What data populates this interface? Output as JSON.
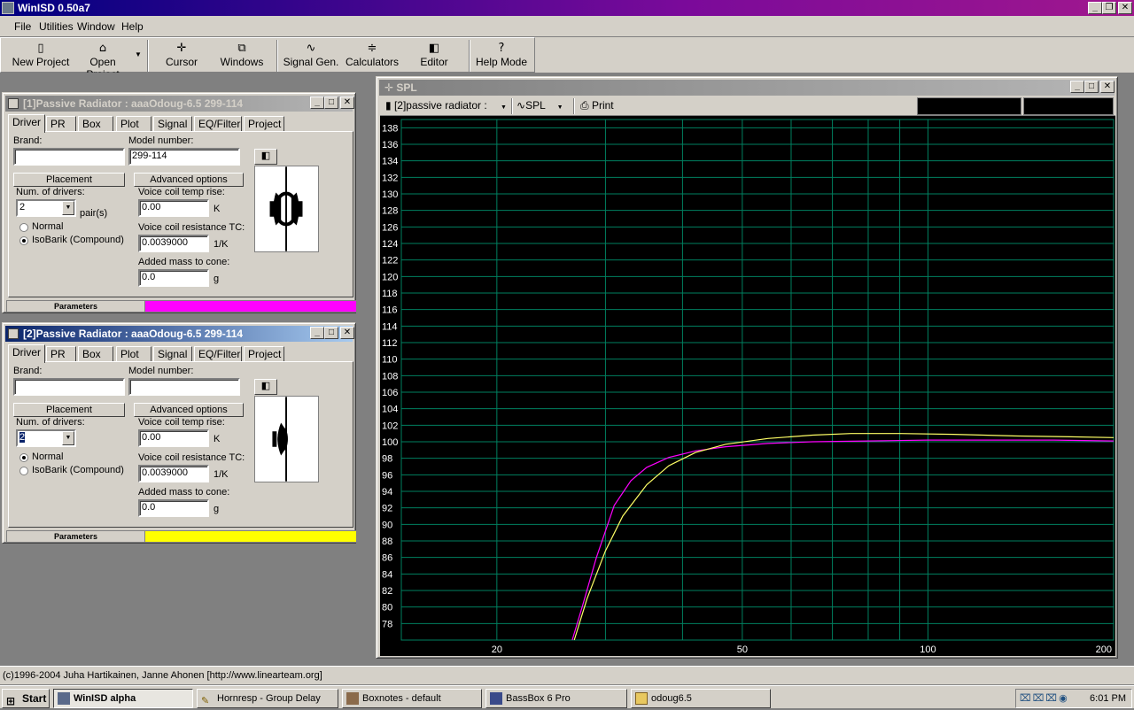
{
  "app": {
    "title": "WinISD 0.50a7",
    "caption_buttons": [
      "minimize-icon",
      "restore-icon",
      "close-icon"
    ]
  },
  "menu": {
    "items": [
      {
        "label": "File"
      },
      {
        "label": "Utilities"
      },
      {
        "label": "Window"
      },
      {
        "label": "Help"
      }
    ]
  },
  "toolbar": {
    "buttons": [
      {
        "label": "New Project",
        "icon": "new-project-icon"
      },
      {
        "label": "Open Project",
        "icon": "open-folder-icon"
      },
      {
        "label": "Cursor",
        "icon": "crosshair-icon"
      },
      {
        "label": "Windows",
        "icon": "windows-icon"
      },
      {
        "label": "Signal Gen.",
        "icon": "sine-wave-icon"
      },
      {
        "label": "Calculators",
        "icon": "calculator-icon"
      },
      {
        "label": "Editor",
        "icon": "speaker-icon"
      },
      {
        "label": "Help Mode",
        "icon": "help-question-icon"
      }
    ]
  },
  "window1": {
    "title": "[1]Passive Radiator : aaaOdoug-6.5 299-114",
    "tabs": [
      "Driver",
      "PR",
      "Box",
      "Plot",
      "Signal",
      "EQ/Filter",
      "Project"
    ],
    "brand_label": "Brand:",
    "brand_value": "",
    "model_label": "Model number:",
    "model_value": "299-114",
    "placement_button": "Placement",
    "advanced_button": "Advanced options",
    "num_drivers_label": "Num. of drivers:",
    "num_drivers_value": "2",
    "pairs_suffix": "pair(s)",
    "radio_normal": "Normal",
    "radio_isobarik": "IsoBarik (Compound)",
    "selected_mode": "IsoBarik (Compound)",
    "vc_temp_label": "Voice coil temp rise:",
    "vc_temp_value": "0.00",
    "vc_temp_unit": "K",
    "vc_res_label": "Voice coil resistance TC:",
    "vc_res_value": "0.0039000",
    "vc_res_unit": "1/K",
    "mass_label": "Added mass to cone:",
    "mass_value": "0.0",
    "mass_unit": "g",
    "params_label": "Parameters",
    "color": "#ff00ff"
  },
  "window2": {
    "title": "[2]Passive Radiator : aaaOdoug-6.5 299-114",
    "tabs": [
      "Driver",
      "PR",
      "Box",
      "Plot",
      "Signal",
      "EQ/Filter",
      "Project"
    ],
    "brand_label": "Brand:",
    "brand_value": "",
    "model_label": "Model number:",
    "model_value": "",
    "placement_button": "Placement",
    "advanced_button": "Advanced options",
    "num_drivers_label": "Num. of drivers:",
    "num_drivers_value": "2",
    "radio_normal": "Normal",
    "radio_isobarik": "IsoBarik (Compound)",
    "selected_mode": "Normal",
    "vc_temp_label": "Voice coil temp rise:",
    "vc_temp_value": "0.00",
    "vc_temp_unit": "K",
    "vc_res_label": "Voice coil resistance TC:",
    "vc_res_value": "0.0039000",
    "vc_res_unit": "1/K",
    "mass_label": "Added mass to cone:",
    "mass_value": "0.0",
    "mass_unit": "g",
    "params_label": "Parameters",
    "color": "#ffff00"
  },
  "spl_window": {
    "title": "SPL",
    "project_select": "[2]passive radiator :",
    "graph_select": "SPL",
    "print_label": "Print"
  },
  "chart_data": {
    "type": "line",
    "xscale": "log",
    "xlim": [
      14,
      200
    ],
    "ylim": [
      76,
      139
    ],
    "x_ticks": [
      20,
      50,
      100,
      200
    ],
    "y_ticks": [
      78,
      80,
      82,
      84,
      86,
      88,
      90,
      92,
      94,
      96,
      98,
      100,
      102,
      104,
      106,
      108,
      110,
      112,
      114,
      116,
      118,
      120,
      122,
      124,
      126,
      128,
      130,
      132,
      134,
      136,
      138
    ],
    "grid": true,
    "background": "#000000",
    "grid_color": "#008060",
    "series": [
      {
        "color": "#ff00ff",
        "x": [
          26.5,
          27.5,
          29,
          31,
          33,
          35,
          38,
          42,
          47,
          55,
          65,
          80,
          100,
          130,
          160,
          200
        ],
        "y": [
          76,
          80,
          86,
          92.3,
          95.3,
          96.9,
          98.1,
          98.9,
          99.4,
          99.8,
          100.0,
          100.1,
          100.2,
          100.2,
          100.2,
          100.1
        ]
      },
      {
        "color": "#ffff66",
        "x": [
          26.7,
          28,
          30,
          32,
          35,
          38,
          42,
          47,
          55,
          65,
          75,
          90,
          110,
          140,
          170,
          200
        ],
        "y": [
          76,
          81,
          86.8,
          91,
          94.8,
          97.1,
          98.7,
          99.7,
          100.4,
          100.8,
          101.0,
          101.0,
          100.9,
          100.7,
          100.6,
          100.5
        ]
      }
    ]
  },
  "status": {
    "text": "(c)1996-2004 Juha Hartikainen, Janne Ahonen [http://www.linearteam.org]"
  },
  "taskbar": {
    "start_label": "Start",
    "tasks": [
      {
        "label": "WinISD alpha",
        "active": true
      },
      {
        "label": "Hornresp - Group Delay",
        "active": false
      },
      {
        "label": "Boxnotes - default",
        "active": false
      },
      {
        "label": "BassBox 6 Pro",
        "active": false
      },
      {
        "label": "odoug6.5",
        "active": false
      }
    ],
    "clock": "6:01 PM"
  }
}
